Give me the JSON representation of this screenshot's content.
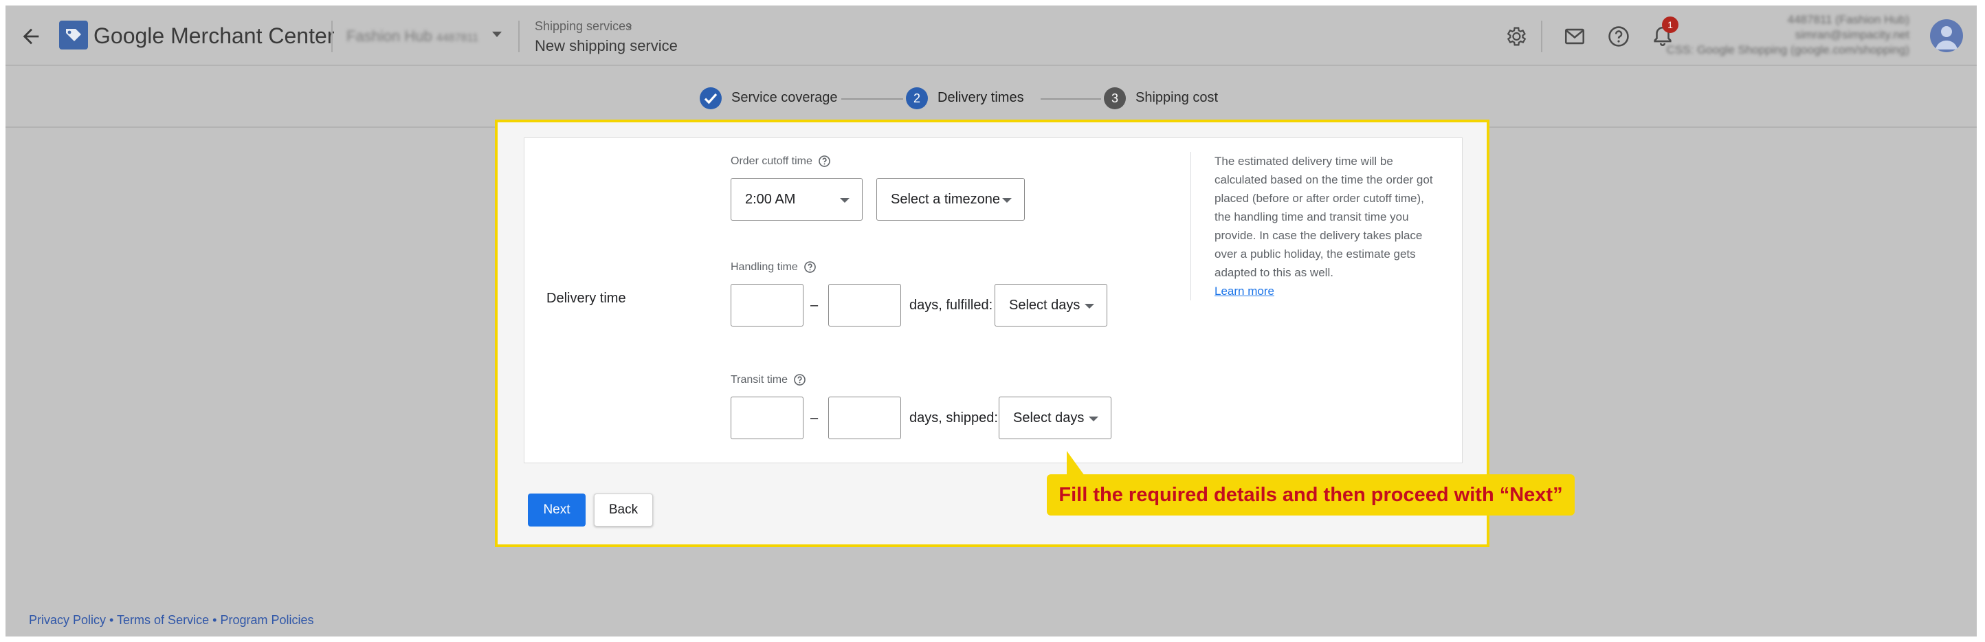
{
  "header": {
    "app_name": "Google Merchant Center",
    "account_name": "Fashion Hub",
    "account_id": "4487811",
    "breadcrumb_parent": "Shipping services",
    "page_title": "New shipping service",
    "notification_count": "1",
    "user_lines": [
      "4487811 (Fashion Hub)",
      "simran@simpacity.net",
      "CSS: Google Shopping (google.com/shopping)"
    ]
  },
  "stepper": {
    "steps": [
      {
        "number": "1",
        "label": "Service coverage",
        "state": "done"
      },
      {
        "number": "2",
        "label": "Delivery times",
        "state": "active"
      },
      {
        "number": "3",
        "label": "Shipping cost",
        "state": "upcoming"
      }
    ]
  },
  "form": {
    "row_label": "Delivery time",
    "order_cutoff": {
      "label": "Order cutoff time",
      "time_value": "2:00 AM",
      "timezone_value": "Select a timezone"
    },
    "handling": {
      "label": "Handling time",
      "min": "",
      "max": "",
      "dash": "–",
      "suffix": "days, fulfilled:",
      "days_value": "Select days"
    },
    "transit": {
      "label": "Transit time",
      "min": "",
      "max": "",
      "dash": "–",
      "suffix": "days, shipped:",
      "days_value": "Select days"
    },
    "info_text": "The estimated delivery time will be calculated based on the time the order got placed (before or after order cutoff time), the handling time and transit time you provide. In case the delivery takes place over a public holiday, the estimate gets adapted to this as well.",
    "learn_more": "Learn more"
  },
  "buttons": {
    "next": "Next",
    "back": "Back"
  },
  "callout": {
    "text": "Fill the required details and then proceed with “Next”"
  },
  "footer": {
    "privacy": "Privacy Policy",
    "terms": "Terms of Service",
    "policies": "Program Policies",
    "separator": "•"
  },
  "colors": {
    "accent": "#1a73e8",
    "highlight": "#f4d400",
    "callout_text": "#c40d1e",
    "overlay": "#c3c3c3"
  }
}
